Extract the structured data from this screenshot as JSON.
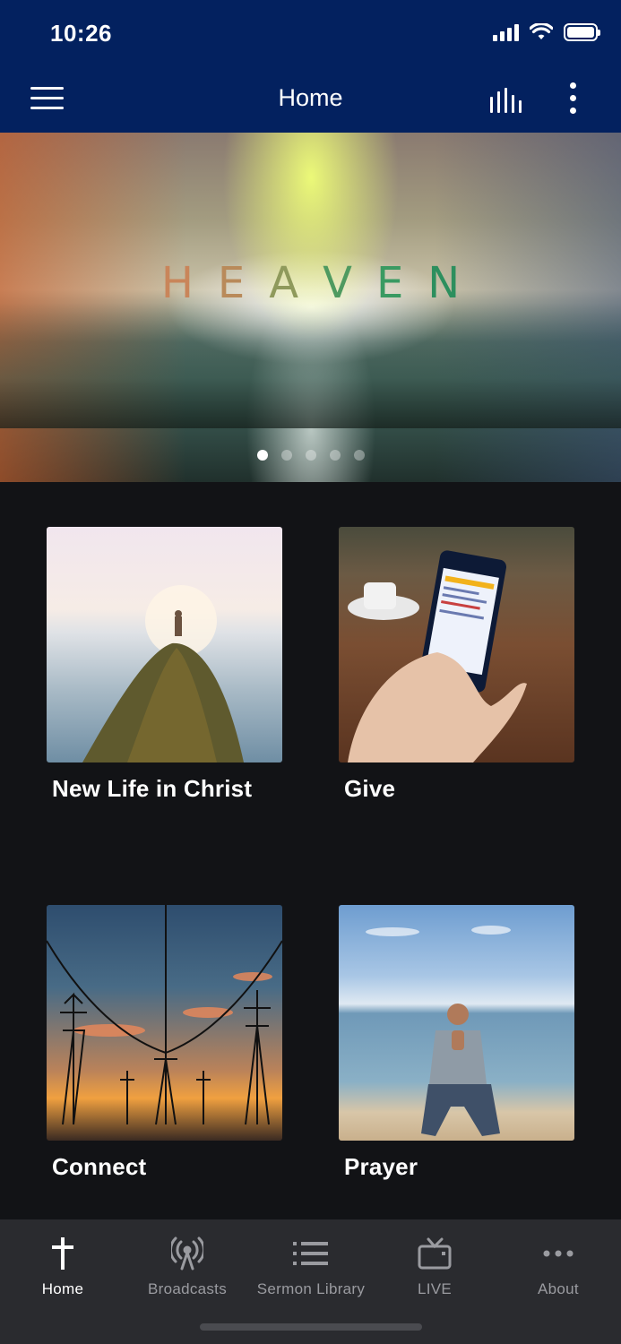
{
  "status_bar": {
    "time": "10:26"
  },
  "header": {
    "title": "Home"
  },
  "hero": {
    "title": "HEAVEN",
    "letter_colors": [
      "#c9855a",
      "#b98a5a",
      "#8f9a5c",
      "#4f9a60",
      "#3a9a62",
      "#2d8f5e"
    ],
    "slides": 5,
    "active_slide": 1
  },
  "tiles": [
    {
      "label": "New Life in Christ"
    },
    {
      "label": "Give"
    },
    {
      "label": "Connect"
    },
    {
      "label": "Prayer"
    }
  ],
  "tabbar": {
    "items": [
      {
        "label": "Home",
        "icon": "cross-icon",
        "active": true
      },
      {
        "label": "Broadcasts",
        "icon": "broadcast-tower-icon",
        "active": false
      },
      {
        "label": "Sermon Library",
        "icon": "list-icon",
        "active": false
      },
      {
        "label": "LIVE",
        "icon": "tv-icon",
        "active": false
      },
      {
        "label": "About",
        "icon": "more-horizontal-icon",
        "active": false
      }
    ]
  },
  "colors": {
    "header_bg": "#03215f",
    "body_bg": "#121316",
    "tabbar_bg": "#2a2b2f",
    "tab_inactive": "#9a9ba0"
  }
}
